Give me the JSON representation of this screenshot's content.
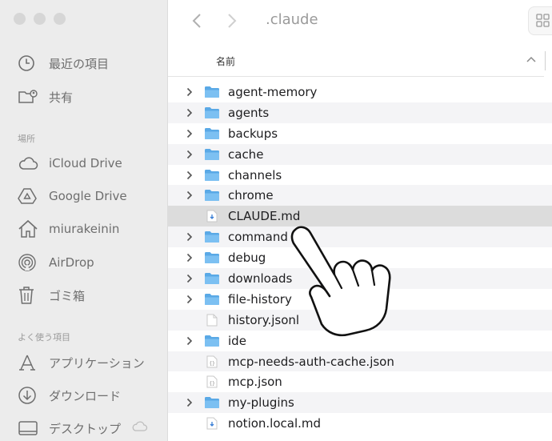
{
  "window": {
    "title": ".claude"
  },
  "sidebar": {
    "recents": [
      {
        "label": "最近の項目",
        "icon": "clock-icon"
      },
      {
        "label": "共有",
        "icon": "shared-folder-icon"
      }
    ],
    "locations_title": "場所",
    "locations": [
      {
        "label": "iCloud Drive",
        "icon": "cloud-icon"
      },
      {
        "label": "Google Drive",
        "icon": "google-drive-icon"
      },
      {
        "label": "miurakeinin",
        "icon": "home-icon"
      },
      {
        "label": "AirDrop",
        "icon": "airdrop-icon"
      },
      {
        "label": "ゴミ箱",
        "icon": "trash-icon"
      }
    ],
    "favorites_title": "よく使う項目",
    "favorites": [
      {
        "label": "アプリケーション",
        "icon": "applications-icon"
      },
      {
        "label": "ダウンロード",
        "icon": "download-icon"
      },
      {
        "label": "デスクトップ",
        "icon": "desktop-icon"
      }
    ]
  },
  "columns": {
    "name": "名前"
  },
  "files": [
    {
      "name": "agent-memory",
      "kind": "folder"
    },
    {
      "name": "agents",
      "kind": "folder"
    },
    {
      "name": "backups",
      "kind": "folder"
    },
    {
      "name": "cache",
      "kind": "folder"
    },
    {
      "name": "channels",
      "kind": "folder"
    },
    {
      "name": "chrome",
      "kind": "folder"
    },
    {
      "name": "CLAUDE.md",
      "kind": "markdown",
      "selected": true
    },
    {
      "name": "command",
      "kind": "folder"
    },
    {
      "name": "debug",
      "kind": "folder"
    },
    {
      "name": "downloads",
      "kind": "folder"
    },
    {
      "name": "file-history",
      "kind": "folder"
    },
    {
      "name": "history.jsonl",
      "kind": "document"
    },
    {
      "name": "ide",
      "kind": "folder"
    },
    {
      "name": "mcp-needs-auth-cache.json",
      "kind": "json"
    },
    {
      "name": "mcp.json",
      "kind": "json"
    },
    {
      "name": "my-plugins",
      "kind": "folder"
    },
    {
      "name": "notion.local.md",
      "kind": "markdown"
    }
  ],
  "colors": {
    "folder": "#5aa9e6",
    "selection": "#dcdcdc"
  }
}
